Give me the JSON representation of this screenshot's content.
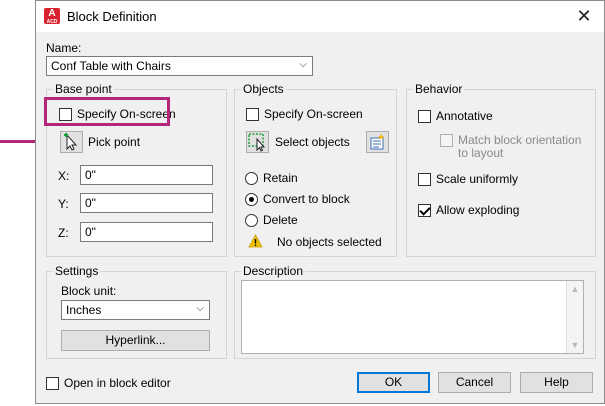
{
  "window": {
    "title": "Block Definition",
    "app_icon_letter": "A",
    "app_icon_sub": "ACD",
    "close_glyph": "✕"
  },
  "name": {
    "label": "Name:",
    "value": "Conf Table with Chairs"
  },
  "base_point": {
    "title": "Base point",
    "specify_onscreen": "Specify On-screen",
    "specify_checked": false,
    "pick_point": "Pick point",
    "x_label": "X:",
    "x_value": "0\"",
    "y_label": "Y:",
    "y_value": "0\"",
    "z_label": "Z:",
    "z_value": "0\""
  },
  "objects": {
    "title": "Objects",
    "specify_onscreen": "Specify On-screen",
    "select_objects": "Select objects",
    "retain": "Retain",
    "convert_to_block": "Convert to block",
    "delete": "Delete",
    "selected_option": "Convert to block",
    "status": "No objects selected"
  },
  "behavior": {
    "title": "Behavior",
    "annotative": "Annotative",
    "annotative_checked": false,
    "match_orientation_line1": "Match block orientation",
    "match_orientation_line2": "to layout",
    "match_orientation_enabled": false,
    "scale_uniformly": "Scale uniformly",
    "scale_uniformly_checked": false,
    "allow_exploding": "Allow exploding",
    "allow_exploding_checked": true
  },
  "settings": {
    "title": "Settings",
    "block_unit_label": "Block unit:",
    "block_unit_value": "Inches",
    "hyperlink": "Hyperlink..."
  },
  "description": {
    "title": "Description",
    "value": ""
  },
  "footer": {
    "open_in_block_editor": "Open in block editor",
    "open_checked": false,
    "ok": "OK",
    "cancel": "Cancel",
    "help": "Help"
  },
  "annotation": {
    "highlight_color": "#b5267a"
  }
}
